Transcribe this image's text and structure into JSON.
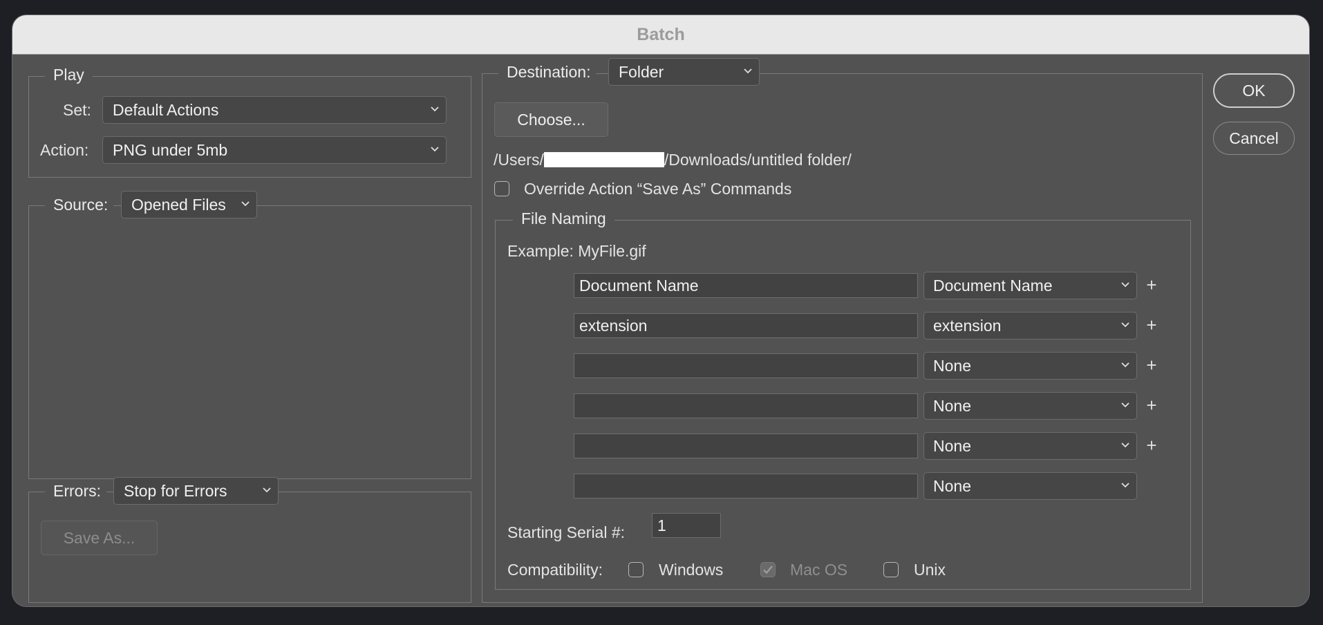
{
  "dialog": {
    "title": "Batch"
  },
  "play": {
    "legend": "Play",
    "set_label": "Set:",
    "set_value": "Default Actions",
    "action_label": "Action:",
    "action_value": "PNG under 5mb"
  },
  "source": {
    "label": "Source:",
    "value": "Opened Files"
  },
  "errors": {
    "label": "Errors:",
    "value": "Stop for Errors",
    "save_as": "Save As..."
  },
  "destination": {
    "label": "Destination:",
    "value": "Folder",
    "choose": "Choose...",
    "path_prefix": "/Users/",
    "path_suffix": "/Downloads/untitled folder/",
    "override_label": "Override Action “Save As” Commands",
    "override_checked": false
  },
  "naming": {
    "legend": "File Naming",
    "example": "Example: MyFile.gif",
    "rows": [
      {
        "text": "Document Name",
        "select": "Document Name"
      },
      {
        "text": "extension",
        "select": "extension"
      },
      {
        "text": "",
        "select": "None"
      },
      {
        "text": "",
        "select": "None"
      },
      {
        "text": "",
        "select": "None"
      },
      {
        "text": "",
        "select": "None"
      }
    ],
    "serial_label": "Starting Serial #:",
    "serial_value": "1",
    "compat_label": "Compatibility:",
    "windows": "Windows",
    "macos": "Mac OS",
    "unix": "Unix"
  },
  "buttons": {
    "ok": "OK",
    "cancel": "Cancel"
  },
  "icons": {
    "dropdown": "chevron-down-icon",
    "add": "plus-icon",
    "check": "checkmark-icon"
  }
}
